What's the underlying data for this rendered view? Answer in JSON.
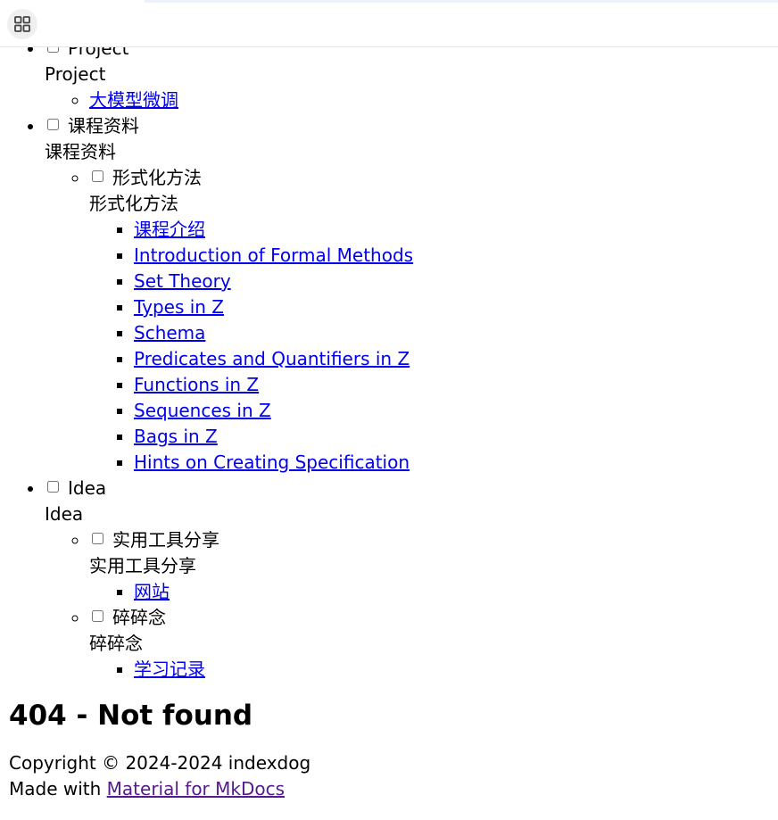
{
  "nav": {
    "project": {
      "label": "Project",
      "title": "Project",
      "items": [
        {
          "label": "大模型微调"
        }
      ]
    },
    "course": {
      "label": "课程资料",
      "title": "课程资料",
      "formal": {
        "label": "形式化方法",
        "title": "形式化方法",
        "items": [
          {
            "label": "课程介绍"
          },
          {
            "label": "Introduction of Formal Methods"
          },
          {
            "label": "Set Theory"
          },
          {
            "label": "Types in Z"
          },
          {
            "label": "Schema"
          },
          {
            "label": "Predicates and Quantifiers in Z"
          },
          {
            "label": "Functions in Z"
          },
          {
            "label": "Sequences in Z"
          },
          {
            "label": "Bags in Z"
          },
          {
            "label": "Hints on Creating Specification"
          }
        ]
      }
    },
    "idea": {
      "label": "Idea",
      "title": "Idea",
      "tools": {
        "label": "实用工具分享",
        "title": "实用工具分享",
        "items": [
          {
            "label": "网站"
          }
        ]
      },
      "notes": {
        "label": "碎碎念",
        "title": "碎碎念",
        "items": [
          {
            "label": "学习记录"
          }
        ]
      }
    }
  },
  "main": {
    "heading": "404 - Not found"
  },
  "footer": {
    "copyright": "Copyright © 2024-2024 indexdog",
    "made_with_prefix": "Made with ",
    "made_with_link": "Material for MkDocs"
  },
  "icons": {
    "apps": "grid-apps-icon"
  },
  "colors": {
    "link": "#0000ee",
    "visited_link": "#551a8b"
  }
}
